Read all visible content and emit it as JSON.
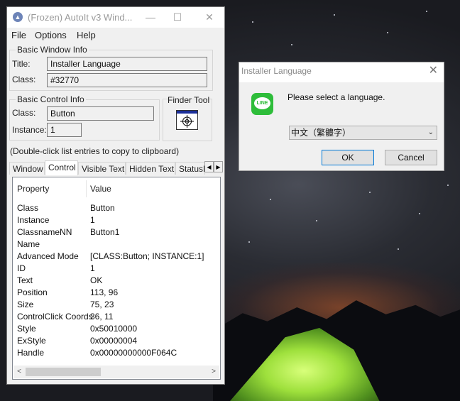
{
  "autoit": {
    "title": "(Frozen) AutoIt v3 Wind...",
    "minimize": "—",
    "maximize": "☐",
    "close": "✕",
    "menu": [
      "File",
      "Options",
      "Help"
    ],
    "basic_window": {
      "group": "Basic Window Info",
      "title_label": "Title:",
      "title_value": "Installer Language",
      "class_label": "Class:",
      "class_value": "#32770"
    },
    "basic_control": {
      "group": "Basic Control Info",
      "class_label": "Class:",
      "class_value": "Button",
      "instance_label": "Instance:",
      "instance_value": "1"
    },
    "finder_tool": "Finder Tool",
    "hint": "(Double-click list entries to copy to clipboard)",
    "tabs": [
      "Window",
      "Control",
      "Visible Text",
      "Hidden Text",
      "StatusB"
    ],
    "active_tab": "Control",
    "list": {
      "col_property": "Property",
      "col_value": "Value",
      "rows": [
        {
          "k": "Class",
          "v": "Button"
        },
        {
          "k": "Instance",
          "v": "1"
        },
        {
          "k": "ClassnameNN",
          "v": "Button1"
        },
        {
          "k": "Name",
          "v": ""
        },
        {
          "k": "Advanced Mode",
          "v": "[CLASS:Button; INSTANCE:1]"
        },
        {
          "k": "ID",
          "v": "1"
        },
        {
          "k": "Text",
          "v": "OK"
        },
        {
          "k": "Position",
          "v": "113, 96"
        },
        {
          "k": "Size",
          "v": "75, 23"
        },
        {
          "k": "ControlClick Coords",
          "v": "36, 11"
        },
        {
          "k": "Style",
          "v": "0x50010000"
        },
        {
          "k": "ExStyle",
          "v": "0x00000004"
        },
        {
          "k": "Handle",
          "v": "0x00000000000F064C"
        }
      ]
    }
  },
  "dialog": {
    "title": "Installer Language",
    "close": "✕",
    "message": "Please select a language.",
    "logo_text": "LINE",
    "selected_language": "中文（繁體字）",
    "ok": "OK",
    "cancel": "Cancel"
  }
}
